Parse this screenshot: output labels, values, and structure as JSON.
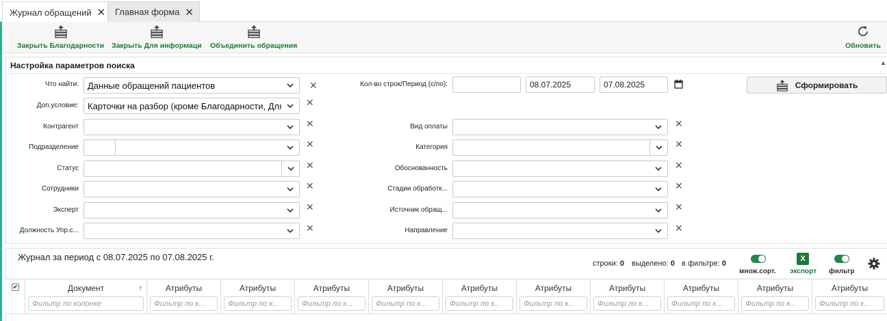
{
  "tabs": [
    {
      "label": "Журнал обращений",
      "active": true
    },
    {
      "label": "Главная форма",
      "active": false
    }
  ],
  "toolbar": {
    "close_thanks": "Закрыть Благодарности",
    "close_info": "Закрыть Для информаци",
    "merge": "Объединить обращения",
    "refresh": "Обновить"
  },
  "panel": {
    "title": "Настройка параметров поиска",
    "what_label": "Что найти:",
    "what_value": "Данные обращений пациентов",
    "extra_label": "Доп.условие:",
    "extra_value": "Карточки на разбор (кроме Благодарности, Для И",
    "contractor_label": "Контрагент",
    "department_label": "Подразделение",
    "status_label": "Статус",
    "staff_label": "Сотрудники",
    "expert_label": "Эксперт",
    "position_label": "Должность Упр.с...",
    "period_label": "Кол-во строк/Период (с/по):",
    "rows_value": "",
    "date_from": "08.07.2025",
    "date_to": "07.08.2025",
    "payment_label": "Вид оплаты",
    "category_label": "Категория",
    "validity_label": "Обоснованность",
    "stages_label": "Стадии обработк...",
    "source_label": "Источник обращ...",
    "direction_label": "Направление",
    "form_button": "Сформировать"
  },
  "journal": {
    "title": "Журнал за период с 08.07.2025 по 07.08.2025 г.",
    "rows_label": "строки:",
    "rows_value": "0",
    "selected_label": "выделено:",
    "selected_value": "0",
    "filtered_label": "в фильтре:",
    "filtered_value": "0",
    "multisort_label": "множ.сорт.",
    "export_label": "экспорт",
    "filter_label": "фильтр",
    "multisort_on": true,
    "filter_on": true
  },
  "grid": {
    "columns": [
      {
        "header": "Документ",
        "filter": "Фильтр по колонке"
      },
      {
        "header": "Атрибуты",
        "filter": "Фильтр по к..."
      },
      {
        "header": "Атрибуты",
        "filter": "Фильтр по к..."
      },
      {
        "header": "Атрибуты",
        "filter": "Фильтр по к..."
      },
      {
        "header": "Атрибуты",
        "filter": "Фильтр по к..."
      },
      {
        "header": "Атрибуты",
        "filter": "Фильтр по к..."
      },
      {
        "header": "Атрибуты",
        "filter": "Фильтр по к..."
      },
      {
        "header": "Атрибуты",
        "filter": "Фильтр по к..."
      },
      {
        "header": "Атрибуты",
        "filter": "Фильтр по к..."
      },
      {
        "header": "Атрибуты",
        "filter": "Фильтр по к..."
      },
      {
        "header": "Атрибуты",
        "filter": "Фильтр по к..."
      }
    ]
  },
  "colors": {
    "accent": "#1e7a3c",
    "sidebar": "#2fae94",
    "toggle": "#1e8a4a",
    "excel": "#1d7a3a"
  }
}
